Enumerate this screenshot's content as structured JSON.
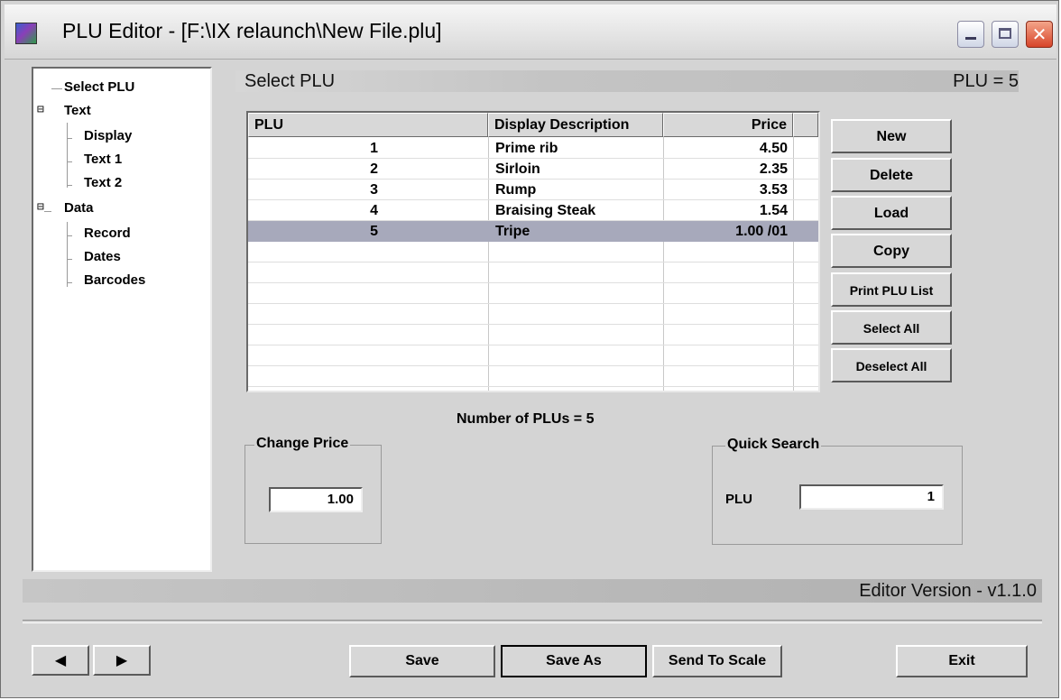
{
  "window": {
    "title": "PLU Editor - [F:\\IX relaunch\\New File.plu]",
    "controls": [
      "minimize-icon",
      "maximize-icon",
      "close-icon"
    ]
  },
  "tree": {
    "items": [
      {
        "label": "Select PLU"
      },
      {
        "label": "Text"
      },
      {
        "label": "Display"
      },
      {
        "label": "Text 1"
      },
      {
        "label": "Text 2"
      },
      {
        "label": "Data"
      },
      {
        "label": "Record"
      },
      {
        "label": "Dates"
      },
      {
        "label": "Barcodes"
      }
    ]
  },
  "header": {
    "title": "Select PLU",
    "plu_indicator": "PLU = 5"
  },
  "table": {
    "columns": [
      "PLU",
      "Display Description",
      "Price"
    ],
    "rows": [
      {
        "plu": "1",
        "description": "Prime rib",
        "price": "4.50"
      },
      {
        "plu": "2",
        "description": "Sirloin",
        "price": "2.35"
      },
      {
        "plu": "3",
        "description": "Rump",
        "price": "3.53"
      },
      {
        "plu": "4",
        "description": "Braising Steak",
        "price": "1.54"
      },
      {
        "plu": "5",
        "description": "Tripe",
        "price": "1.00 /01"
      }
    ],
    "selected_row": 5
  },
  "actions": {
    "new": "New",
    "delete": "Delete",
    "load": "Load",
    "copy": "Copy",
    "print": "Print PLU List",
    "select_all": "Select All",
    "deselect_all": "Deselect All"
  },
  "count_text": "Number of PLUs = 5",
  "change_price": {
    "title": "Change Price",
    "value": "1.00"
  },
  "quick_search": {
    "title": "Quick Search",
    "label": "PLU",
    "value": "1"
  },
  "status": {
    "version": "Editor Version - v1.1.0"
  },
  "footer": {
    "prev": "◀",
    "next": "▶",
    "save": "Save",
    "save_as": "Save As",
    "send": "Send To Scale",
    "exit": "Exit"
  },
  "colors": {
    "selected_row": "#a7a9bb",
    "window_bg": "#d4d4d4",
    "close_button": "#d7452a"
  }
}
